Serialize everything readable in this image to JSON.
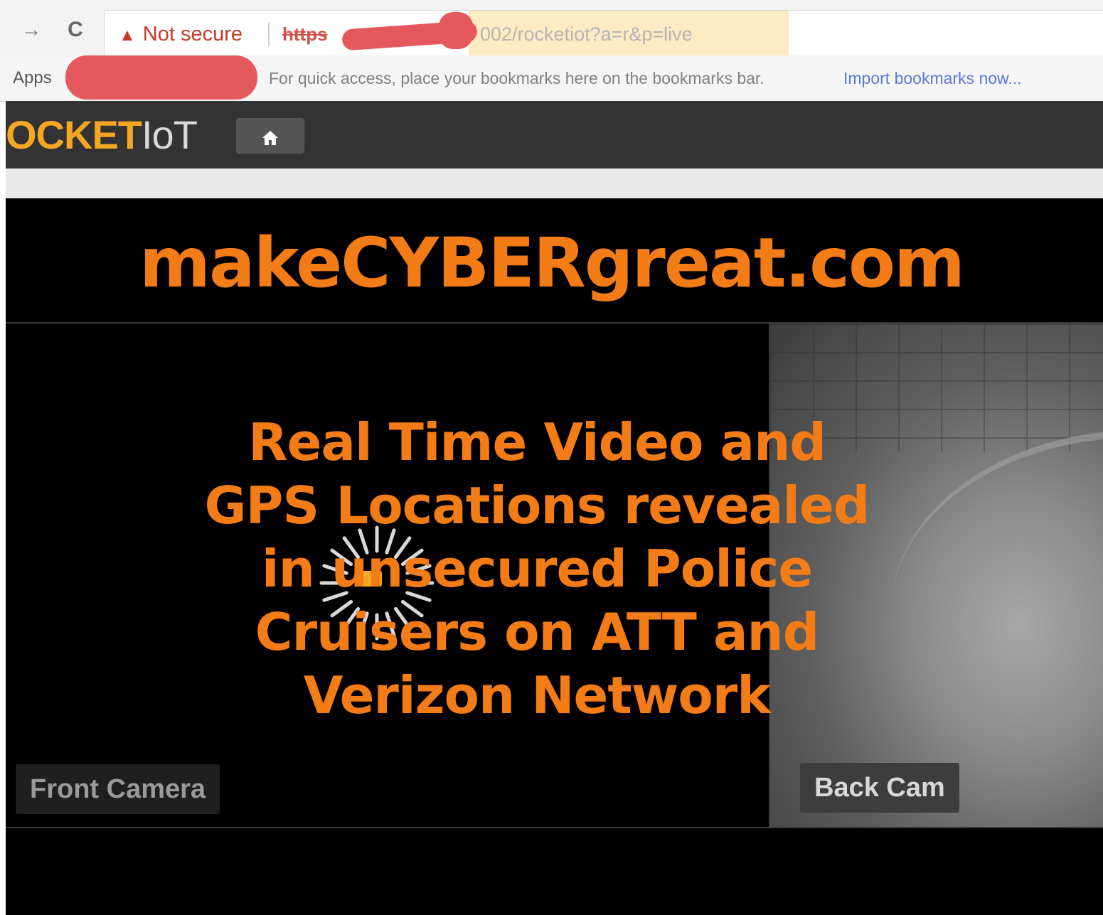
{
  "browser": {
    "back_glyph": "→",
    "reload_glyph": "C",
    "security_warning": "Not secure",
    "url_scheme": "https",
    "url_path": "002/rocketiot?a=r&p=live",
    "bookmarks_bar": {
      "apps_label": "Apps",
      "hint": "For quick access, place your bookmarks here on the bookmarks bar.",
      "import_link": "Import bookmarks now..."
    },
    "redaction_color": "#e5585d"
  },
  "app": {
    "brand_rocket": "OCKET",
    "brand_iot": "IoT",
    "home_icon": "home-icon",
    "brand_color": "#f5a623"
  },
  "video": {
    "front_label": "Front Camera",
    "back_label": "Back Cam",
    "loading_icon": "spinner-icon"
  },
  "overlay": {
    "watermark": "makeCYBERgreat.com",
    "headline_lines": [
      "Real Time Video and",
      "GPS Locations revealed",
      "in unsecured Police",
      "Cruisers on ATT and",
      "Verizon Network"
    ],
    "color": "#f47c17"
  }
}
